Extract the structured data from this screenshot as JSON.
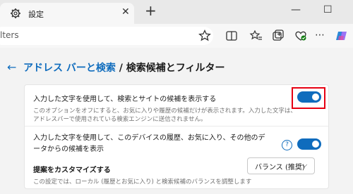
{
  "tab": {
    "title": "設定",
    "close": "✕"
  },
  "newtab": "+",
  "window": {
    "minimize": "—",
    "maximize": "☐"
  },
  "address": {
    "text": "lters"
  },
  "breadcrumb": {
    "parent": "アドレス バーと検索",
    "separator": "/",
    "current": "検索候補とフィルター"
  },
  "back": "←",
  "settings": {
    "suggestions": {
      "label": "入力した文字を使用して、検索とサイトの候補を表示する",
      "description": "このオプションをオフにすると、お気に入りや履歴の候補だけが表示されます。入力した文字は、アドレスバーで使用されている検索エンジンに送信されません。",
      "enabled": true
    },
    "history": {
      "label": "入力した文字を使用して、このデバイスの履歴、お気に入り、その他のデータからの候補を表示",
      "help": "?",
      "enabled": true
    },
    "customize": {
      "label": "提案をカスタマイズする",
      "description": "この設定では、ローカル (履歴とお気に入り) と検索候補のバランスを調整します",
      "selected": "バランス (推奨)",
      "chevron": "⌵"
    }
  },
  "colors": {
    "accent": "#0f6cbd",
    "highlight": "#e60012"
  }
}
